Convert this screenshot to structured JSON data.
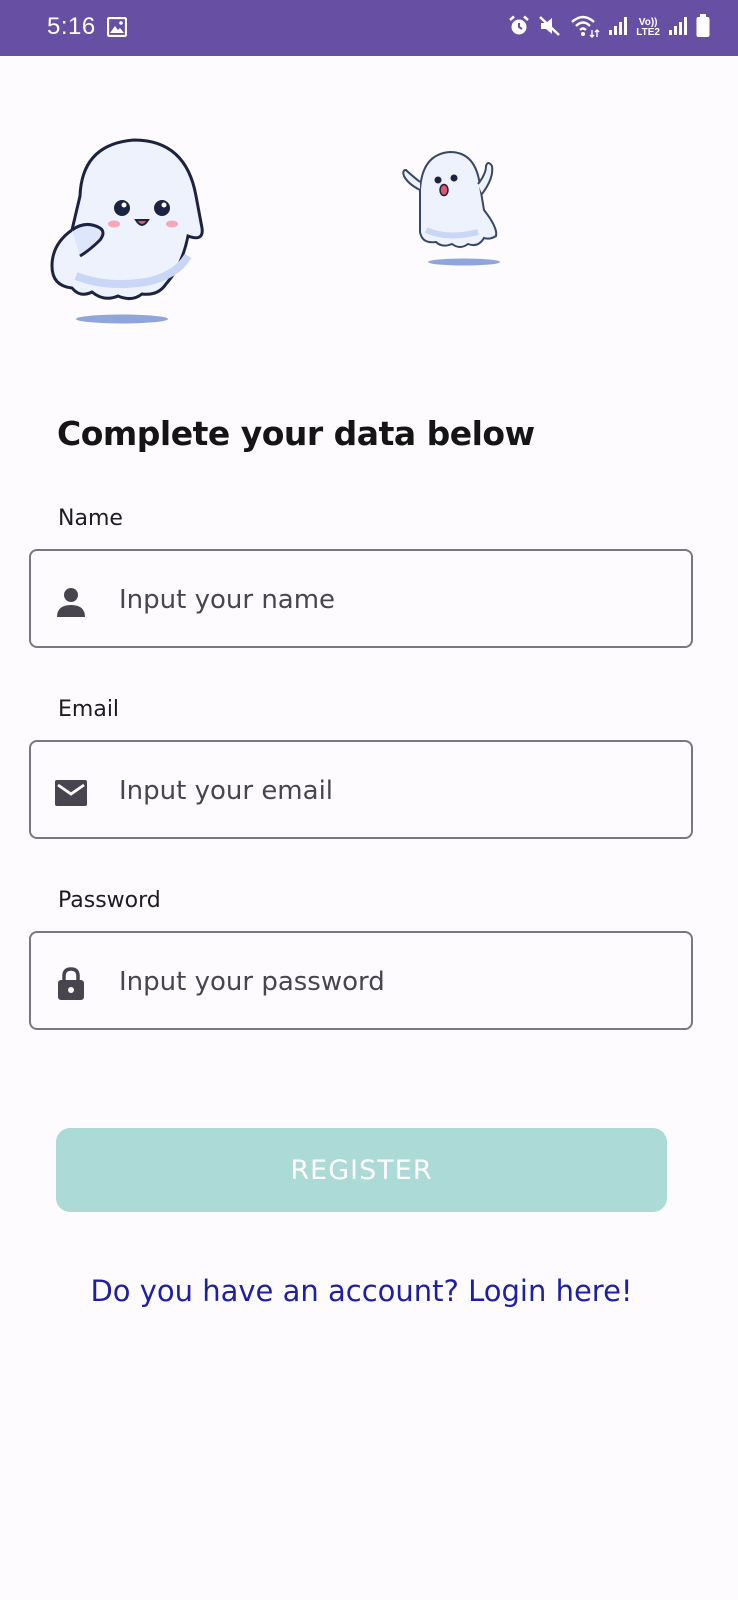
{
  "status_bar": {
    "time": "5:16",
    "network_label_top": "Vo))",
    "network_label_bottom": "LTE2",
    "background": "#6750a4",
    "icons": [
      "gallery-icon",
      "alarm-icon",
      "mute-icon",
      "wifi-icon",
      "signal-icon",
      "volte-icon",
      "signal-icon",
      "battery-icon"
    ]
  },
  "form": {
    "heading": "Complete your data below",
    "name": {
      "label": "Name",
      "placeholder": "Input your name",
      "value": "",
      "icon": "person-icon"
    },
    "email": {
      "label": "Email",
      "placeholder": "Input your email",
      "value": "",
      "icon": "mail-icon"
    },
    "password": {
      "label": "Password",
      "placeholder": "Input your password",
      "value": "",
      "icon": "lock-icon"
    }
  },
  "register_button": {
    "label": "REGISTER",
    "color": "#acdad6",
    "enabled": false
  },
  "login_link": {
    "label": "Do you have an account? Login here!",
    "color": "#1d1fa6"
  }
}
